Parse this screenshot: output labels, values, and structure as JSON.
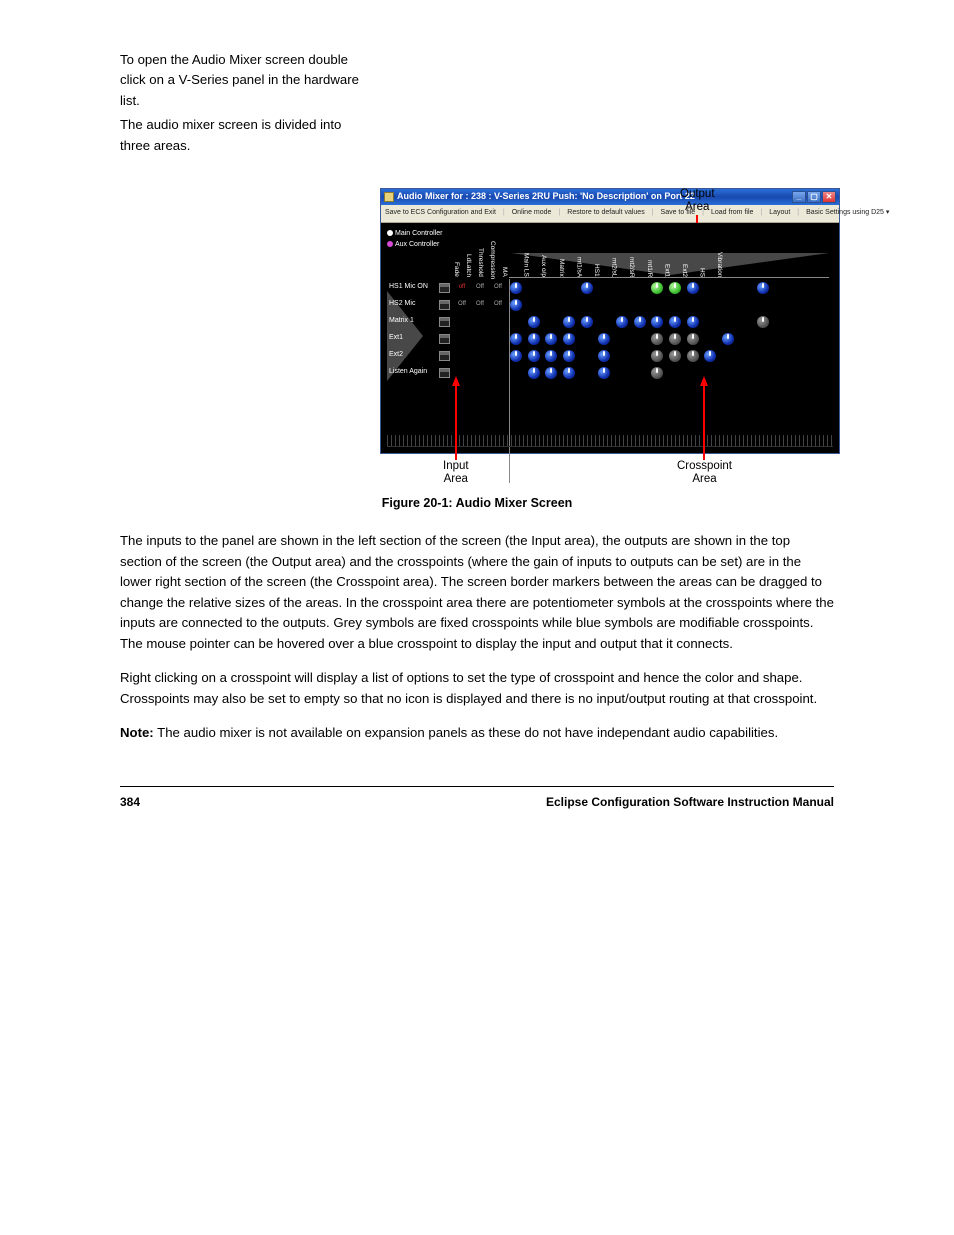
{
  "intro": {
    "line1": "To open the Audio Mixer screen double click on a V-Series panel in the hardware list.",
    "line2": "The audio mixer screen is divided into three areas."
  },
  "annotations": {
    "output": "Output\nArea",
    "input": "Input\nArea",
    "cross": "Crosspoint\nArea"
  },
  "window": {
    "title": "Audio Mixer for : 238   :  V-Series 2RU Push: 'No Description' on Port 22",
    "menu": [
      "Save to ECS Configuration and Exit",
      "Online mode",
      "Restore to default values",
      "Save to file",
      "Load from file",
      "Layout",
      "Basic Settings using D25  ▾"
    ],
    "controllers": {
      "main": "Main Controller",
      "aux": "Aux Controller"
    },
    "input_col_headers": [
      "Fade",
      "LdLatch",
      "Threshold",
      "Compression",
      "MA"
    ],
    "output_headers": [
      "Main LS",
      "Aux o/p",
      "Matrix",
      "mt1/sA",
      "HS1",
      "mt2/sL",
      "mt2/sR",
      "mt1/R",
      "Ext1",
      "Ext2",
      "HS",
      "Vibration"
    ],
    "input_rows": [
      {
        "label": "HS1 Mic ON",
        "offs": [
          "off",
          "Off",
          "Off",
          "Off"
        ],
        "off_red_first": true
      },
      {
        "label": "HS2 Mic",
        "offs": [
          "Off",
          "Off",
          "Off",
          "Off"
        ],
        "off_red_first": false
      },
      {
        "label": "Matrix 1",
        "offs": [],
        "off_red_first": false
      },
      {
        "label": "Ext1",
        "offs": [],
        "off_red_first": false
      },
      {
        "label": "Ext2",
        "offs": [],
        "off_red_first": false
      },
      {
        "label": "Listen Again",
        "offs": [],
        "off_red_first": false
      }
    ],
    "crosspoints": [
      [
        "b",
        "",
        "",
        "",
        "b",
        "",
        "",
        "",
        "g",
        "g",
        "b",
        "",
        "",
        "",
        "b",
        "",
        "",
        ""
      ],
      [
        "b",
        "",
        "",
        "",
        "",
        "",
        "",
        "",
        "",
        "",
        "",
        "",
        "",
        "",
        "",
        "",
        "",
        ""
      ],
      [
        "",
        "b",
        "",
        "b",
        "b",
        "",
        "b",
        "b",
        "b",
        "b",
        "b",
        "",
        "",
        "",
        "d",
        "",
        "",
        ""
      ],
      [
        "b",
        "b",
        "b",
        "b",
        "",
        "b",
        "",
        "",
        "d",
        "d",
        "d",
        "",
        "b",
        "",
        "",
        "",
        "",
        ""
      ],
      [
        "b",
        "b",
        "b",
        "b",
        "",
        "b",
        "",
        "",
        "d",
        "d",
        "d",
        "b",
        "",
        "",
        "",
        "",
        "",
        ""
      ],
      [
        "",
        "b",
        "b",
        "b",
        "",
        "b",
        "",
        "",
        "d",
        "",
        "",
        "",
        "",
        "",
        "",
        "",
        "",
        ""
      ]
    ]
  },
  "figcap": "Figure 20-1: Audio Mixer Screen",
  "paras": [
    "The inputs to the panel are shown in the left section of the screen (the Input area), the outputs are shown in the top section of the screen (the Output area) and the crosspoints (where the gain of inputs to outputs can be set) are in the lower right section of the screen (the Crosspoint area). The screen border markers between the areas can be dragged to change the relative sizes of the areas. In the crosspoint area there are potentiometer symbols at the crosspoints where the inputs are connected to the outputs. Grey symbols are fixed crosspoints while blue symbols are modifiable crosspoints. The mouse pointer can be hovered over a blue crosspoint to display the input and output that it connects.",
    "Right clicking on a crosspoint will display a list of options to set the type of crosspoint and hence the color and shape. Crosspoints may also be set to empty so that no icon is displayed and there is no input/output routing at that crosspoint."
  ],
  "note_label": "Note:",
  "note_text": "The audio mixer is not available on expansion panels as these do not have independant audio capabilities.",
  "footer": {
    "left": "384",
    "right": "Eclipse Configuration Software Instruction Manual"
  }
}
